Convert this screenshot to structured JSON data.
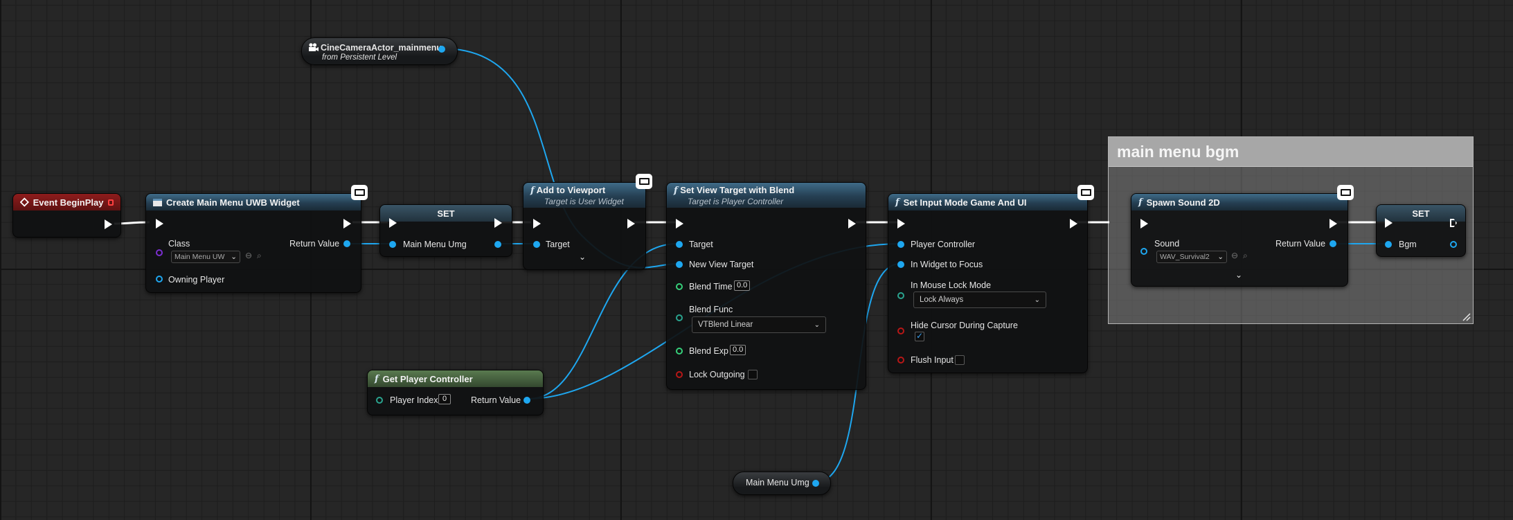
{
  "colors": {
    "exec": "#ffffff",
    "object_pin": "#1ea7f0",
    "class_pin": "#7b2fd1",
    "float_pin": "#36d07a",
    "bool_pin": "#b81717",
    "byte_pin": "#2aa48f",
    "event_header": "#8e1c1c",
    "function_header": "#3f6b88",
    "pure_header": "#597a4f",
    "comment": "#a7a7a7"
  },
  "camera_ref": {
    "title": "CineCameraActor_mainmenu",
    "subtitle": "from Persistent Level",
    "icon": "camera-icon"
  },
  "event_begin": {
    "title": "Event BeginPlay",
    "icon": "event-diamond-icon"
  },
  "create_widget": {
    "title": "Create Main Menu UWB Widget",
    "class_label": "Class",
    "class_value": "Main Menu UW",
    "return_label": "Return Value",
    "owning_label": "Owning Player"
  },
  "set_umg": {
    "title": "SET",
    "var_label": "Main Menu Umg"
  },
  "add_viewport": {
    "title": "Add to Viewport",
    "subtitle": "Target is User Widget",
    "target_label": "Target"
  },
  "set_view_target": {
    "title": "Set View Target with Blend",
    "subtitle": "Target is Player Controller",
    "target_label": "Target",
    "new_view_target_label": "New View Target",
    "blend_time_label": "Blend Time",
    "blend_time_value": "0.0",
    "blend_func_label": "Blend Func",
    "blend_func_value": "VTBlend Linear",
    "blend_exp_label": "Blend Exp",
    "blend_exp_value": "0.0",
    "lock_outgoing_label": "Lock Outgoing"
  },
  "set_input_mode": {
    "title": "Set Input Mode Game And UI",
    "player_controller_label": "Player Controller",
    "widget_focus_label": "In Widget to Focus",
    "mouse_lock_label": "In Mouse Lock Mode",
    "mouse_lock_value": "Lock Always",
    "hide_cursor_label": "Hide Cursor During Capture",
    "hide_cursor_checked": true,
    "flush_input_label": "Flush Input"
  },
  "get_player_controller": {
    "title": "Get Player Controller",
    "player_index_label": "Player Index",
    "player_index_value": "0",
    "return_label": "Return Value"
  },
  "main_menu_umg_getter": {
    "label": "Main Menu Umg"
  },
  "comment": {
    "title": "main menu bgm"
  },
  "spawn_sound": {
    "title": "Spawn Sound 2D",
    "sound_label": "Sound",
    "sound_value": "WAV_Survival2",
    "return_label": "Return Value"
  },
  "set_bgm": {
    "title": "SET",
    "var_label": "Bgm"
  },
  "glyphs": {
    "fn": "f",
    "chevron": "⌄",
    "combo_chev": "⌄",
    "check": "✓"
  }
}
